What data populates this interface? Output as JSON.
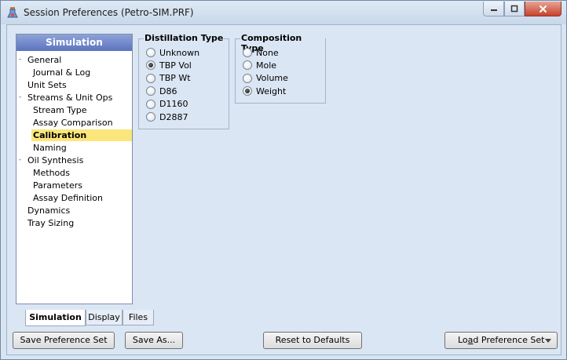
{
  "window": {
    "title": "Session Preferences (Petro-SIM.PRF)"
  },
  "tree": {
    "header": "Simulation",
    "items": [
      {
        "label": "General",
        "level": 0,
        "expander": "-"
      },
      {
        "label": "Journal & Log",
        "level": 1
      },
      {
        "label": "Unit Sets",
        "level": 0
      },
      {
        "label": "Streams & Unit Ops",
        "level": 0,
        "expander": "-"
      },
      {
        "label": "Stream Type",
        "level": 1
      },
      {
        "label": "Assay Comparison",
        "level": 1
      },
      {
        "label": "Calibration",
        "level": 1,
        "selected": true
      },
      {
        "label": "Naming",
        "level": 1
      },
      {
        "label": "Oil Synthesis",
        "level": 0,
        "expander": "-"
      },
      {
        "label": "Methods",
        "level": 1
      },
      {
        "label": "Parameters",
        "level": 1
      },
      {
        "label": "Assay Definition",
        "level": 1
      },
      {
        "label": "Dynamics",
        "level": 0
      },
      {
        "label": "Tray Sizing",
        "level": 0
      }
    ]
  },
  "distillation": {
    "title": "Distillation Type",
    "options": [
      {
        "label": "Unknown",
        "checked": false
      },
      {
        "label": "TBP Vol",
        "checked": true
      },
      {
        "label": "TBP Wt",
        "checked": false
      },
      {
        "label": "D86",
        "checked": false
      },
      {
        "label": "D1160",
        "checked": false
      },
      {
        "label": "D2887",
        "checked": false
      }
    ]
  },
  "composition": {
    "title": "Composition Type",
    "options": [
      {
        "label": "None",
        "checked": false
      },
      {
        "label": "Mole",
        "checked": false
      },
      {
        "label": "Volume",
        "checked": false
      },
      {
        "label": "Weight",
        "checked": true
      }
    ]
  },
  "tabs": [
    {
      "label": "Simulation",
      "active": true
    },
    {
      "label": "Display",
      "active": false
    },
    {
      "label": "Files",
      "active": false
    }
  ],
  "buttons": {
    "save_pref_set": "Save Preference Set",
    "save_as": "Save As...",
    "reset_defaults": "Reset to Defaults",
    "load_pref_pre": "Lo",
    "load_pref_u": "a",
    "load_pref_post": "d Preference Set"
  },
  "colors": {
    "tree_header": "#5c73bf",
    "selected_item": "#fae67a",
    "close_button": "#c7432c"
  }
}
